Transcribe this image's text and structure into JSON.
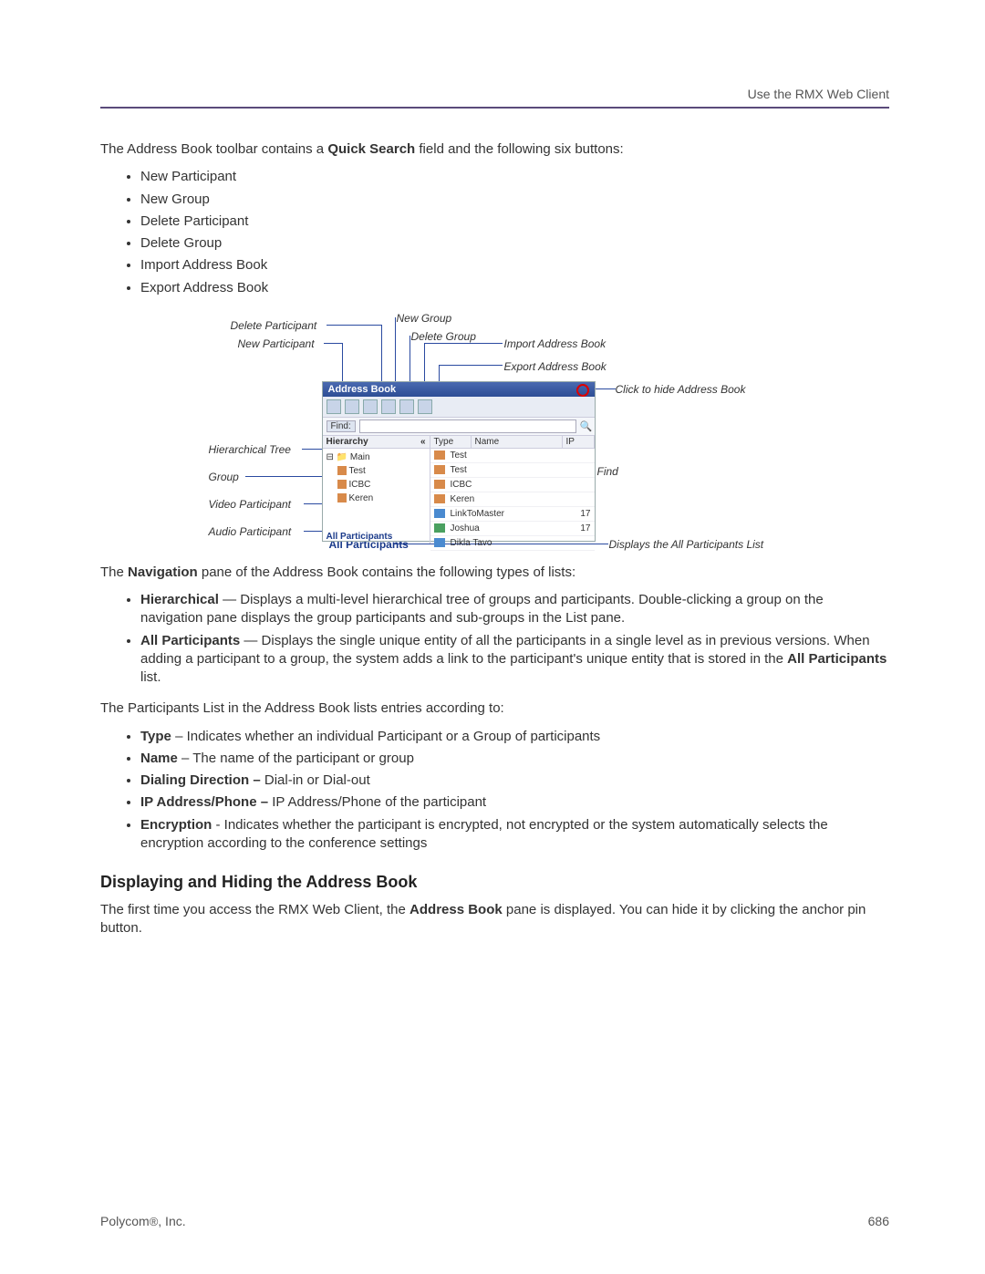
{
  "header": {
    "right": "Use the RMX Web Client"
  },
  "intro": {
    "pre": "The Address Book toolbar contains a ",
    "bold": "Quick Search",
    "post": " field and the following six buttons:"
  },
  "toolbar_list": [
    "New Participant",
    "New Group",
    "Delete Participant",
    "Delete Group",
    "Import Address Book",
    "Export Address Book"
  ],
  "figure": {
    "callouts": {
      "delete_participant": "Delete Participant",
      "new_participant": "New Participant",
      "new_group": "New Group",
      "delete_group": "Delete Group",
      "import_book": "Import Address Book",
      "export_book": "Export Address Book",
      "hide_book": "Click to hide Address Book",
      "hier_tree": "Hierarchical Tree",
      "group": "Group",
      "video_p": "Video Participant",
      "audio_p": "Audio Participant",
      "all_p": "All Participants",
      "find": "Find",
      "all_p_desc": "Displays the All Participants List"
    },
    "panel_title": "Address Book",
    "nav_header": "Hierarchy",
    "nav_collapse": "«",
    "tree": {
      "root": "Main",
      "items": [
        "Test",
        "ICBC",
        "Keren"
      ]
    },
    "find_label": "Find:",
    "list_headers": {
      "type": "Type",
      "name": "Name",
      "ip": "IP"
    },
    "rows": [
      {
        "kind": "g",
        "name": "Test",
        "ip": ""
      },
      {
        "kind": "g",
        "name": "Test",
        "ip": ""
      },
      {
        "kind": "g",
        "name": "ICBC",
        "ip": ""
      },
      {
        "kind": "g",
        "name": "Keren",
        "ip": ""
      },
      {
        "kind": "vp",
        "name": "LinkToMaster",
        "ip": "17"
      },
      {
        "kind": "ap",
        "name": "Joshua",
        "ip": "17"
      },
      {
        "kind": "vp",
        "name": "Dikla Tavo",
        "ip": ""
      }
    ],
    "all_participants_label": "All Participants"
  },
  "nav_para": {
    "pre": "The ",
    "bold": "Navigation",
    "post": " pane of the Address Book contains the following types of lists:"
  },
  "nav_list": [
    {
      "bold": "Hierarchical",
      "text": " — Displays a multi-level hierarchical tree of groups and participants. Double-clicking a group on the navigation pane displays the group participants and sub-groups in the List pane."
    },
    {
      "bold": "All Participants",
      "text_pre": " — Displays the single unique entity of all the participants in a single level as in previous versions. When adding a participant to a group, the system adds a link to the participant's unique entity that is stored in the ",
      "bold2": "All Participants",
      "text_post": " list."
    }
  ],
  "list_para": "The Participants List in the Address Book lists entries according to:",
  "entries_list": [
    {
      "bold": "Type",
      "text": " – Indicates whether an individual Participant or a Group of participants"
    },
    {
      "bold": "Name",
      "text": " – The name of the participant or group"
    },
    {
      "bold": "Dialing Direction –",
      "text": " Dial-in or Dial-out"
    },
    {
      "bold": "IP Address/Phone –",
      "text": " IP Address/Phone of the participant"
    },
    {
      "bold": "Encryption",
      "text": " - Indicates whether the participant is encrypted, not encrypted or the system automatically selects the encryption according to the conference settings"
    }
  ],
  "section_heading": "Displaying and Hiding the Address Book",
  "section_para": {
    "pre": "The first time you access the RMX Web Client, the ",
    "bold": "Address Book",
    "post": " pane is displayed. You can hide it by clicking the anchor pin button."
  },
  "footer": {
    "company_pre": "Polycom",
    "reg": "®",
    "company_post": ", Inc.",
    "page": "686"
  }
}
